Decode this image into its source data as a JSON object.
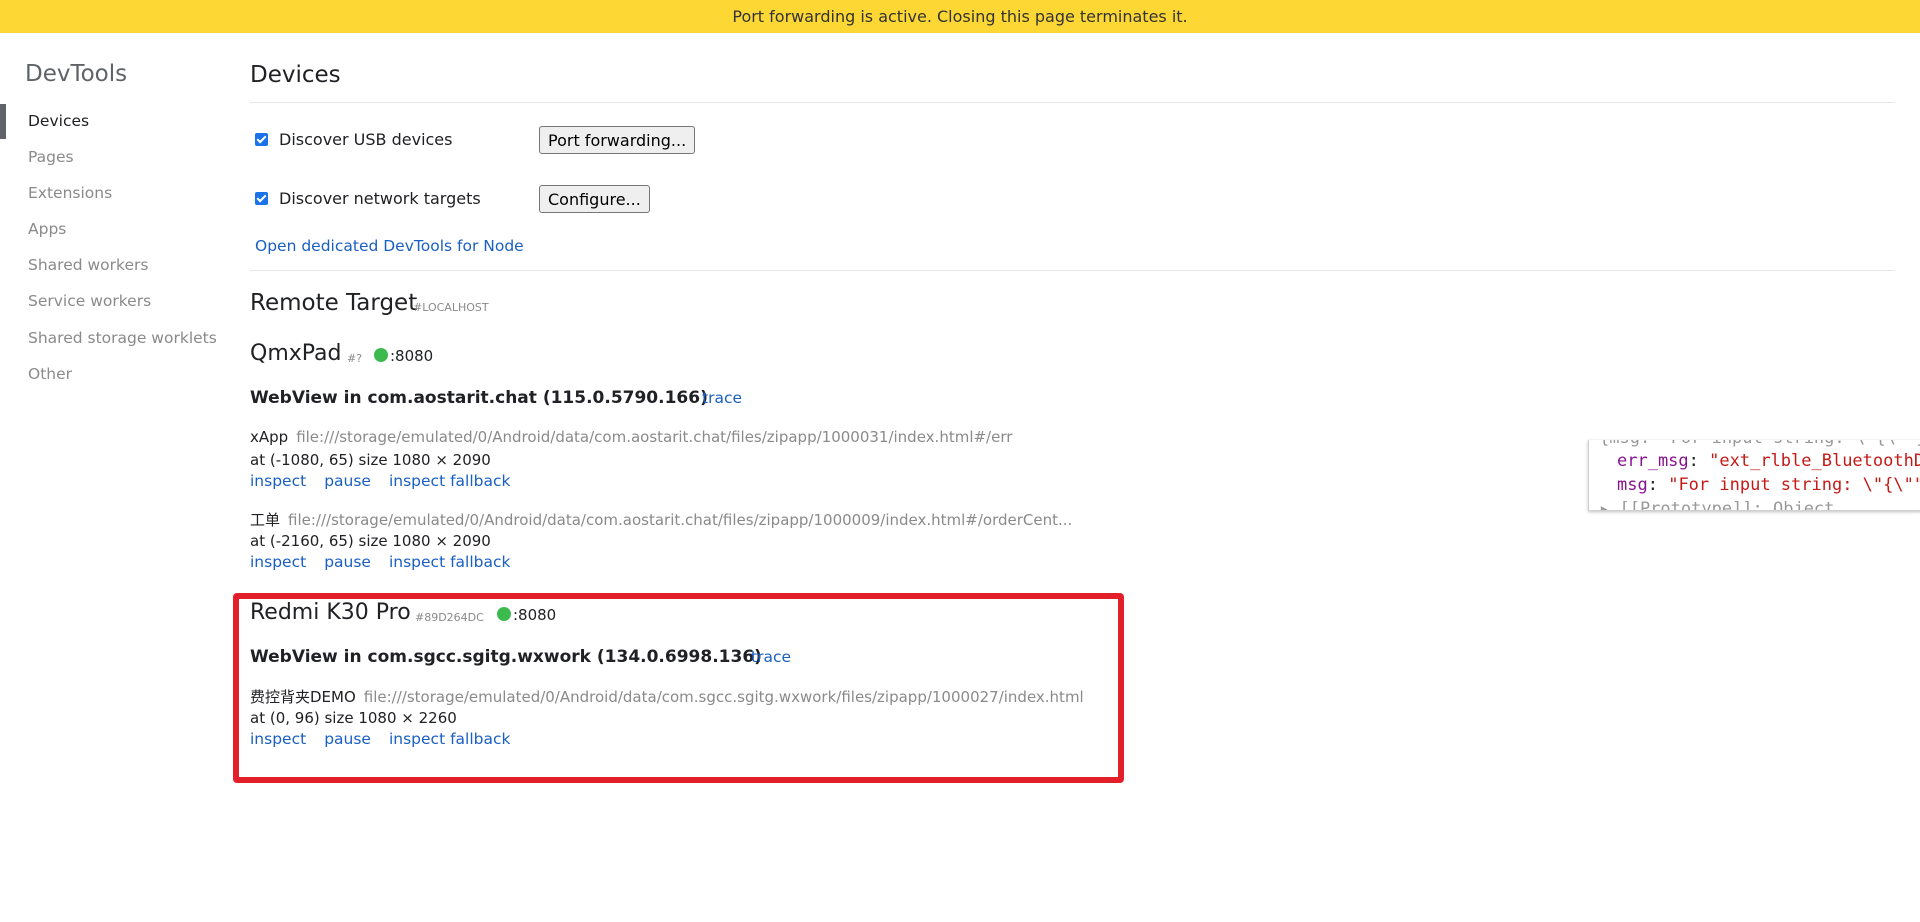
{
  "banner": {
    "text": "Port forwarding is active. Closing this page terminates it."
  },
  "sidebar": {
    "title": "DevTools",
    "items": [
      {
        "label": "Devices",
        "selected": true
      },
      {
        "label": "Pages"
      },
      {
        "label": "Extensions"
      },
      {
        "label": "Apps"
      },
      {
        "label": "Shared workers"
      },
      {
        "label": "Service workers"
      },
      {
        "label": "Shared storage worklets"
      },
      {
        "label": "Other"
      }
    ]
  },
  "devices": {
    "heading": "Devices",
    "discover_usb": {
      "label": "Discover USB devices",
      "checked": true
    },
    "port_forwarding_button": "Port forwarding...",
    "discover_network": {
      "label": "Discover network targets",
      "checked": true
    },
    "configure_button": "Configure...",
    "node_link": "Open dedicated DevTools for Node"
  },
  "remote": {
    "heading": "Remote Target",
    "subheading": "#LOCALHOST",
    "devices": [
      {
        "name": "QmxPad",
        "serial": "#?",
        "port": ":8080",
        "browser": "WebView in com.aostarit.chat (115.0.5790.166)",
        "trace": "trace",
        "targets": [
          {
            "name": "xApp",
            "url": "file:///storage/emulated/0/Android/data/com.aostarit.chat/files/zipapp/1000031/index.html#/err",
            "meta": "at (-1080, 65)  size 1080 × 2090"
          },
          {
            "name": "工单",
            "url": "file:///storage/emulated/0/Android/data/com.aostarit.chat/files/zipapp/1000009/index.html#/orderCent...",
            "meta": "at (-2160, 65)  size 1080 × 2090"
          }
        ]
      },
      {
        "name": "Redmi K30 Pro",
        "serial": "#89D264DC",
        "port": ":8080",
        "browser": "WebView in com.sgcc.sgitg.wxwork (134.0.6998.136)",
        "trace": "trace",
        "targets": [
          {
            "name": "费控背夹DEMO",
            "url": "file:///storage/emulated/0/Android/data/com.sgcc.sgitg.wxwork/files/zipapp/1000027/index.html",
            "meta": "at (0, 96)  size 1080 × 2260"
          }
        ]
      }
    ],
    "actions": {
      "inspect": "inspect",
      "pause": "pause",
      "fallback": "inspect fallback"
    }
  },
  "console_popup": {
    "line0": "{msg: \"For input string: \\\"{\\\"\"}",
    "err_key": "err_msg",
    "err_val": "\"ext_rlble_BluetoothD",
    "msg_key": "msg",
    "msg_val": "\"For input string: \\\"{\\\"\"",
    "proto": "▸ [[Prototype]]: Object"
  },
  "colors": {
    "banner": "#fdd835",
    "link": "#1a5fc2",
    "highlight_box": "#e3202a",
    "status_online": "#3dba4e"
  }
}
